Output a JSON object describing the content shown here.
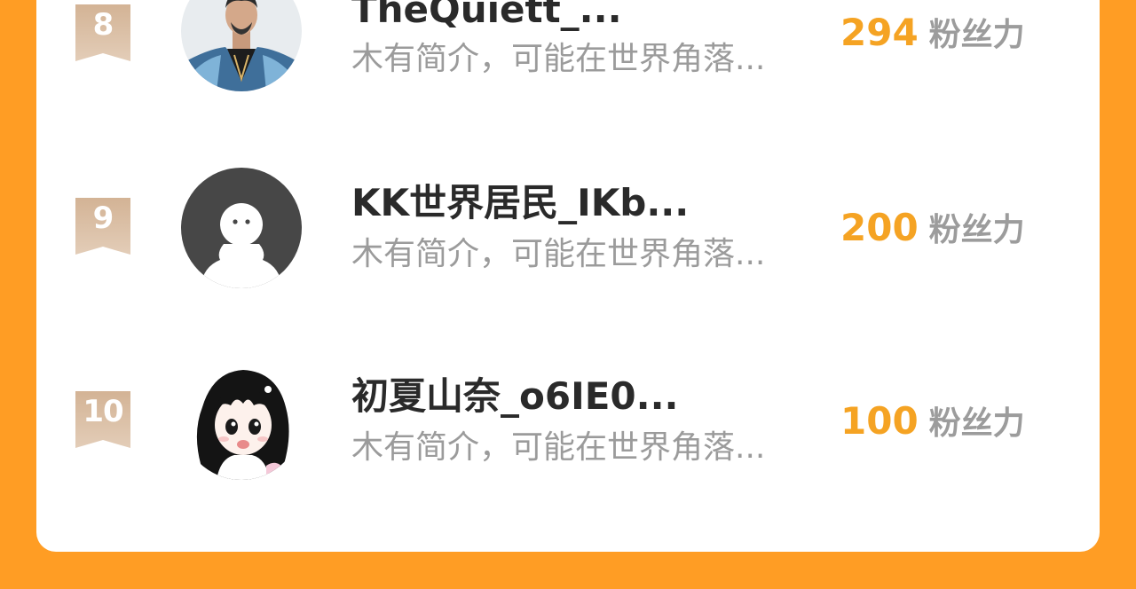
{
  "colors": {
    "background": "#FF9D24",
    "card": "#ffffff",
    "fans_count": "#F5A323",
    "badge": "#D7B89C"
  },
  "leaderboard": {
    "rows": [
      {
        "rank": "8",
        "name": "TheQuiett_...",
        "bio": "木有简介，可能在世界角落...",
        "fans_count": "294",
        "fans_label": "粉丝力",
        "avatar_icon": "man-with-beard-photo"
      },
      {
        "rank": "9",
        "name": "KK世界居民_IKb...",
        "bio": "木有简介，可能在世界角落...",
        "fans_count": "200",
        "fans_label": "粉丝力",
        "avatar_icon": "default-avatar-icon"
      },
      {
        "rank": "10",
        "name": "初夏山奈_o6IE0...",
        "bio": "木有简介，可能在世界角落...",
        "fans_count": "100",
        "fans_label": "粉丝力",
        "avatar_icon": "anime-girl-avatar"
      }
    ]
  }
}
